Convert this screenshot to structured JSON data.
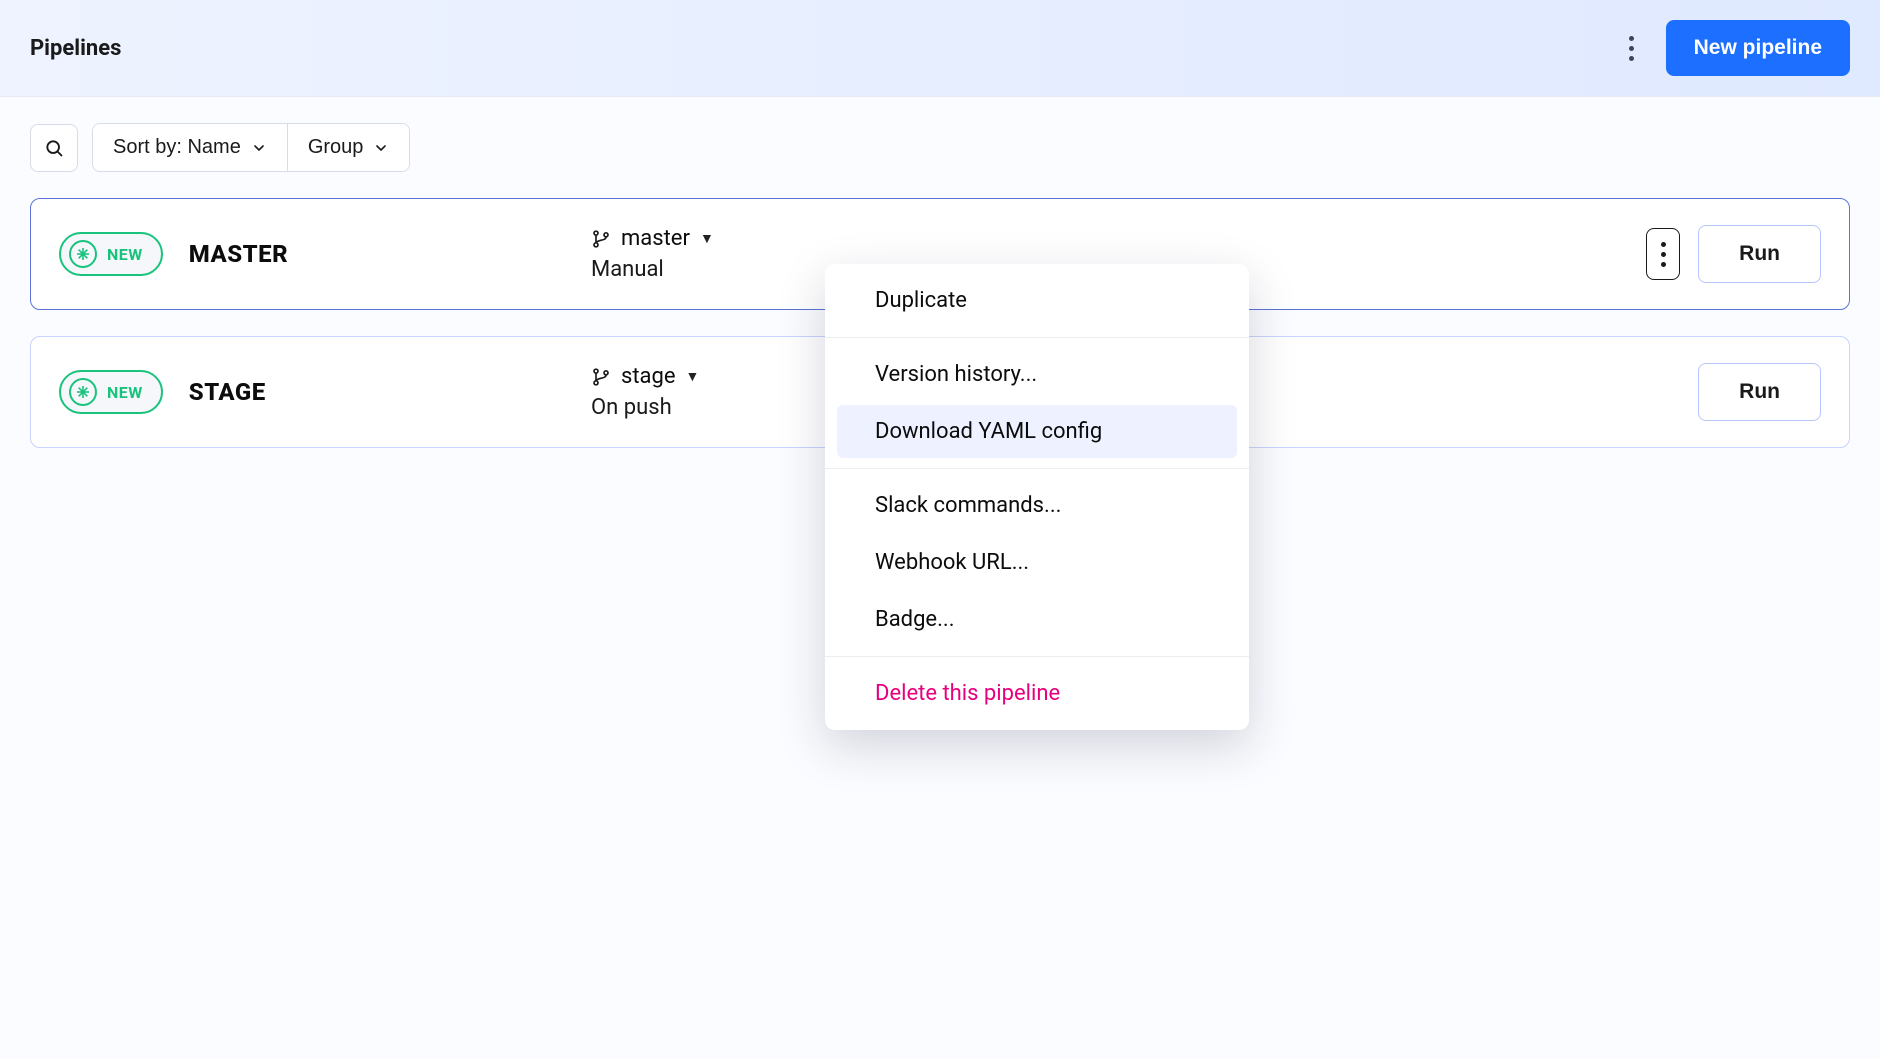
{
  "header": {
    "title": "Pipelines",
    "new_button": "New pipeline"
  },
  "toolbar": {
    "sort_label": "Sort by: Name",
    "group_label": "Group"
  },
  "pipelines": [
    {
      "status_label": "NEW",
      "name": "MASTER",
      "branch": "master",
      "trigger": "Manual",
      "run_label": "Run",
      "active": true,
      "menu_open": true
    },
    {
      "status_label": "NEW",
      "name": "STAGE",
      "branch": "stage",
      "trigger": "On push",
      "run_label": "Run",
      "active": false,
      "menu_open": false
    }
  ],
  "menu": {
    "items": [
      {
        "label": "Duplicate",
        "group": 0
      },
      {
        "label": "Version history...",
        "group": 1
      },
      {
        "label": "Download YAML config",
        "group": 1,
        "hover": true
      },
      {
        "label": "Slack commands...",
        "group": 2
      },
      {
        "label": "Webhook URL...",
        "group": 2
      },
      {
        "label": "Badge...",
        "group": 2
      },
      {
        "label": "Delete this pipeline",
        "group": 3,
        "danger": true
      }
    ]
  }
}
